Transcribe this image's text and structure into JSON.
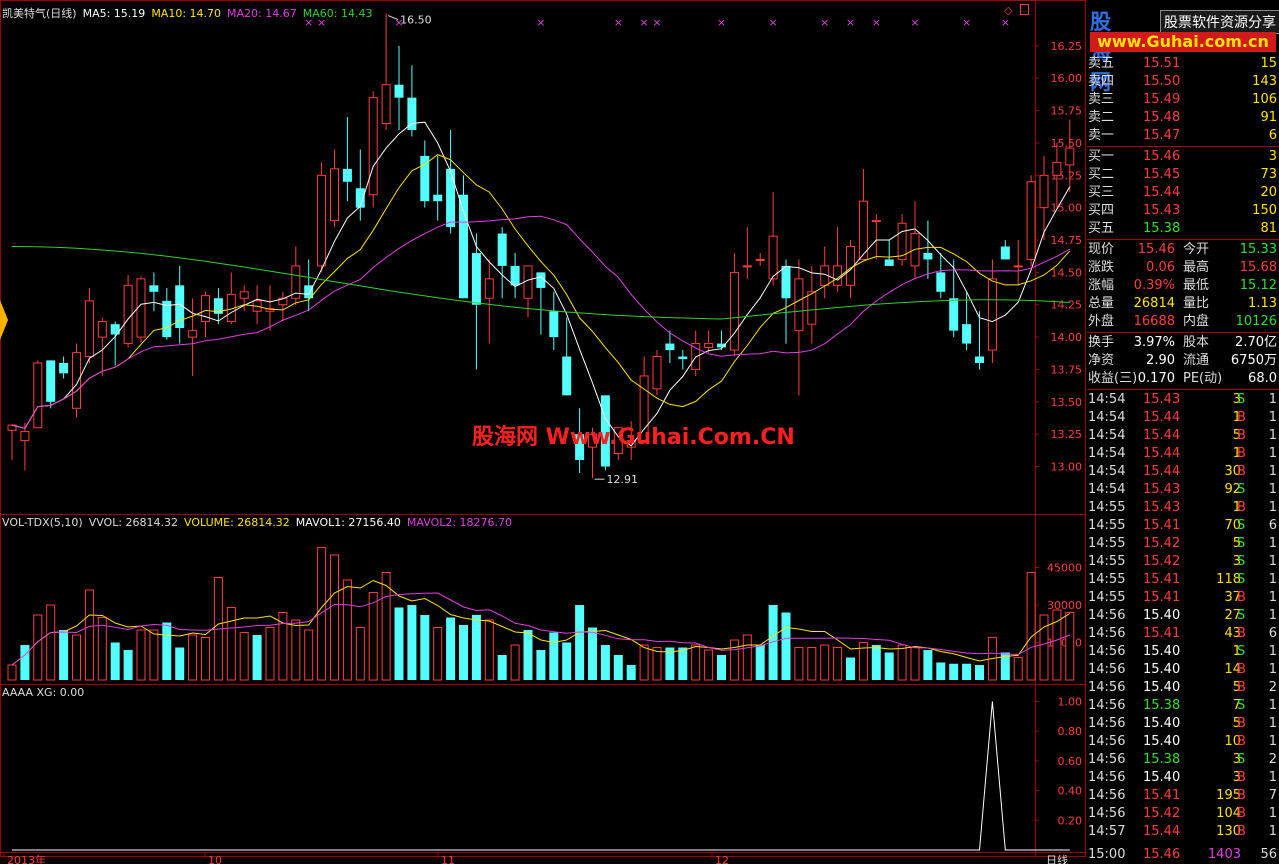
{
  "header": {
    "stock": "凯美特气(日线)",
    "ma5": "MA5: 15.19",
    "ma10": "MA10: 14.70",
    "ma20": "MA20: 14.67",
    "ma60": "MA60: 14.43"
  },
  "price_axis": [
    "16.25",
    "16.00",
    "15.75",
    "15.50",
    "15.25",
    "15.00",
    "14.75",
    "14.50",
    "14.25",
    "14.00",
    "13.75",
    "13.50",
    "13.25",
    "13.00"
  ],
  "annotations": {
    "high": "16.50",
    "low": "12.91"
  },
  "vol_header": {
    "name": "VOL-TDX(5,10)",
    "vvol": "VVOL: 26814.32",
    "volume": "VOLUME: 26814.32",
    "mavol1": "MAVOL1: 27156.40",
    "mavol2": "MAVOL2: 18276.70"
  },
  "vol_axis": [
    "45000",
    "30000",
    "15000"
  ],
  "ind_header": "AAAA XG: 0.00",
  "ind_axis": [
    "1.00",
    "0.80",
    "0.60",
    "0.40",
    "0.20"
  ],
  "date_axis": [
    "2013年",
    "10",
    "11",
    "12"
  ],
  "period_label": "日线",
  "watermark": "股海网 Www.Guhai.Com.CN",
  "logo": {
    "brand": "股海网",
    "sub": "股票软件资源分享",
    "url": "www.Guhai.com.cn"
  },
  "colors": {
    "up": "#ff3c3c",
    "down": "#54ffff",
    "ma5": "#ffffff",
    "ma10": "#ffe200",
    "ma20": "#e040e0",
    "ma60": "#30d030"
  },
  "order_book": {
    "asks": [
      {
        "label": "卖五",
        "price": "15.51",
        "vol": "15"
      },
      {
        "label": "卖四",
        "price": "15.50",
        "vol": "143"
      },
      {
        "label": "卖三",
        "price": "15.49",
        "vol": "106"
      },
      {
        "label": "卖二",
        "price": "15.48",
        "vol": "91"
      },
      {
        "label": "卖一",
        "price": "15.47",
        "vol": "6"
      }
    ],
    "bids": [
      {
        "label": "买一",
        "price": "15.46",
        "vol": "3"
      },
      {
        "label": "买二",
        "price": "15.45",
        "vol": "73"
      },
      {
        "label": "买三",
        "price": "15.44",
        "vol": "20"
      },
      {
        "label": "买四",
        "price": "15.43",
        "vol": "150"
      },
      {
        "label": "买五",
        "price": "15.38",
        "vol": "81"
      }
    ]
  },
  "quote": [
    {
      "l1": "现价",
      "v1": "15.46",
      "c1": "red",
      "l2": "今开",
      "v2": "15.33",
      "c2": "grn"
    },
    {
      "l1": "涨跌",
      "v1": "0.06",
      "c1": "red",
      "l2": "最高",
      "v2": "15.68",
      "c2": "red"
    },
    {
      "l1": "涨幅",
      "v1": "0.39%",
      "c1": "red",
      "l2": "最低",
      "v2": "15.12",
      "c2": "grn"
    },
    {
      "l1": "总量",
      "v1": "26814",
      "c1": "yel",
      "l2": "量比",
      "v2": "1.13",
      "c2": "yel"
    },
    {
      "l1": "外盘",
      "v1": "16688",
      "c1": "red",
      "l2": "内盘",
      "v2": "10126",
      "c2": "grn"
    }
  ],
  "fundamentals": [
    {
      "l1": "换手",
      "v1": "3.97%",
      "l2": "股本",
      "v2": "2.70亿"
    },
    {
      "l1": "净资",
      "v1": "2.90",
      "l2": "流通",
      "v2": "6750万"
    },
    {
      "l1": "收益(三)",
      "v1": "0.170",
      "l2": "PE(动)",
      "v2": "68.0"
    }
  ],
  "ticks": [
    {
      "t": "14:54",
      "p": "15.43",
      "v": "3",
      "bs": "S",
      "n": "1"
    },
    {
      "t": "14:54",
      "p": "15.44",
      "v": "1",
      "bs": "B",
      "n": "1"
    },
    {
      "t": "14:54",
      "p": "15.44",
      "v": "5",
      "bs": "B",
      "n": "1"
    },
    {
      "t": "14:54",
      "p": "15.44",
      "v": "1",
      "bs": "B",
      "n": "1"
    },
    {
      "t": "14:54",
      "p": "15.44",
      "v": "30",
      "bs": "B",
      "n": "1"
    },
    {
      "t": "14:54",
      "p": "15.43",
      "v": "92",
      "bs": "S",
      "n": "1"
    },
    {
      "t": "14:55",
      "p": "15.43",
      "v": "1",
      "bs": "B",
      "n": "1"
    },
    {
      "t": "14:55",
      "p": "15.41",
      "v": "70",
      "bs": "S",
      "n": "6"
    },
    {
      "t": "14:55",
      "p": "15.42",
      "v": "5",
      "bs": "S",
      "n": "1"
    },
    {
      "t": "14:55",
      "p": "15.42",
      "v": "3",
      "bs": "S",
      "n": "1"
    },
    {
      "t": "14:55",
      "p": "15.41",
      "v": "118",
      "bs": "S",
      "n": "1"
    },
    {
      "t": "14:55",
      "p": "15.41",
      "v": "37",
      "bs": "B",
      "n": "1"
    },
    {
      "t": "14:56",
      "p": "15.40",
      "v": "27",
      "bs": "S",
      "n": "1"
    },
    {
      "t": "14:56",
      "p": "15.41",
      "v": "43",
      "bs": "B",
      "n": "6"
    },
    {
      "t": "14:56",
      "p": "15.40",
      "v": "1",
      "bs": "S",
      "n": "1"
    },
    {
      "t": "14:56",
      "p": "15.40",
      "v": "14",
      "bs": "B",
      "n": "1"
    },
    {
      "t": "14:56",
      "p": "15.40",
      "v": "5",
      "bs": "B",
      "n": "2"
    },
    {
      "t": "14:56",
      "p": "15.38",
      "v": "7",
      "bs": "S",
      "n": "1"
    },
    {
      "t": "14:56",
      "p": "15.40",
      "v": "5",
      "bs": "B",
      "n": "1"
    },
    {
      "t": "14:56",
      "p": "15.40",
      "v": "10",
      "bs": "B",
      "n": "1"
    },
    {
      "t": "14:56",
      "p": "15.38",
      "v": "3",
      "bs": "S",
      "n": "2"
    },
    {
      "t": "14:56",
      "p": "15.40",
      "v": "3",
      "bs": "B",
      "n": "1"
    },
    {
      "t": "14:56",
      "p": "15.41",
      "v": "195",
      "bs": "B",
      "n": "7"
    },
    {
      "t": "14:56",
      "p": "15.42",
      "v": "104",
      "bs": "B",
      "n": "1"
    },
    {
      "t": "14:57",
      "p": "15.44",
      "v": "130",
      "bs": "B",
      "n": "1"
    }
  ],
  "ticks_partial": {
    "t": "15:00",
    "p": "15.46",
    "v": "1403",
    "n": "56"
  },
  "chart_data": {
    "type": "candlestick",
    "title": "凯美特气(日线)",
    "ylim": [
      12.78,
      16.45
    ],
    "candles": [
      [
        13.28,
        13.32,
        13.05,
        13.32
      ],
      [
        13.2,
        13.34,
        12.97,
        13.27
      ],
      [
        13.3,
        13.82,
        13.3,
        13.8
      ],
      [
        13.82,
        13.82,
        13.45,
        13.5
      ],
      [
        13.8,
        13.85,
        13.68,
        13.72
      ],
      [
        13.45,
        13.95,
        13.38,
        13.88
      ],
      [
        13.85,
        14.38,
        13.8,
        14.28
      ],
      [
        14.0,
        14.15,
        13.7,
        14.12
      ],
      [
        14.1,
        14.12,
        13.78,
        14.02
      ],
      [
        13.95,
        14.48,
        13.92,
        14.4
      ],
      [
        14.0,
        14.47,
        13.96,
        14.45
      ],
      [
        14.4,
        14.5,
        14.2,
        14.35
      ],
      [
        14.28,
        14.38,
        13.98,
        14.0
      ],
      [
        14.4,
        14.55,
        13.95,
        14.07
      ],
      [
        14.0,
        14.3,
        13.7,
        14.05
      ],
      [
        14.12,
        14.35,
        14.0,
        14.32
      ],
      [
        14.3,
        14.38,
        14.1,
        14.18
      ],
      [
        14.12,
        14.5,
        14.1,
        14.33
      ],
      [
        14.3,
        14.4,
        14.2,
        14.35
      ],
      [
        14.2,
        14.4,
        14.1,
        14.28
      ],
      [
        14.2,
        14.4,
        14.05,
        14.22
      ],
      [
        14.25,
        14.35,
        14.12,
        14.3
      ],
      [
        14.3,
        14.7,
        14.25,
        14.55
      ],
      [
        14.4,
        14.6,
        14.2,
        14.3
      ],
      [
        14.55,
        15.35,
        14.5,
        15.25
      ],
      [
        14.9,
        15.45,
        14.85,
        15.3
      ],
      [
        15.3,
        15.7,
        15.05,
        15.2
      ],
      [
        15.15,
        15.45,
        14.9,
        15.0
      ],
      [
        15.1,
        15.9,
        15.0,
        15.85
      ],
      [
        15.65,
        16.5,
        15.6,
        15.95
      ],
      [
        15.95,
        16.25,
        15.6,
        15.85
      ],
      [
        15.85,
        16.1,
        15.55,
        15.6
      ],
      [
        15.4,
        15.52,
        15.0,
        15.05
      ],
      [
        15.1,
        15.4,
        14.9,
        15.05
      ],
      [
        15.3,
        15.6,
        14.8,
        14.85
      ],
      [
        15.1,
        15.25,
        14.3,
        14.3
      ],
      [
        14.65,
        14.8,
        13.75,
        14.25
      ],
      [
        14.3,
        14.6,
        13.95,
        14.45
      ],
      [
        14.8,
        14.85,
        14.3,
        14.55
      ],
      [
        14.55,
        14.65,
        14.3,
        14.4
      ],
      [
        14.3,
        14.55,
        14.15,
        14.55
      ],
      [
        14.5,
        14.5,
        14.02,
        14.38
      ],
      [
        14.2,
        14.35,
        13.9,
        14.0
      ],
      [
        13.85,
        14.15,
        13.55,
        13.55
      ],
      [
        13.25,
        13.45,
        12.95,
        13.05
      ],
      [
        13.15,
        13.3,
        12.91,
        13.25
      ],
      [
        13.55,
        13.55,
        12.97,
        13.0
      ],
      [
        13.1,
        13.3,
        13.05,
        13.3
      ],
      [
        13.15,
        13.35,
        13.05,
        13.2
      ],
      [
        13.2,
        13.85,
        13.2,
        13.7
      ],
      [
        13.6,
        13.9,
        13.55,
        13.85
      ],
      [
        13.95,
        14.05,
        13.8,
        13.9
      ],
      [
        13.85,
        13.9,
        13.75,
        13.83
      ],
      [
        13.75,
        14.05,
        13.7,
        13.95
      ],
      [
        13.92,
        14.05,
        13.88,
        13.95
      ],
      [
        13.95,
        14.05,
        13.9,
        13.92
      ],
      [
        13.9,
        14.65,
        13.85,
        14.5
      ],
      [
        14.55,
        14.85,
        14.45,
        14.55
      ],
      [
        14.6,
        14.65,
        14.55,
        14.6
      ],
      [
        14.45,
        15.12,
        14.4,
        14.78
      ],
      [
        14.55,
        14.6,
        13.95,
        14.3
      ],
      [
        14.05,
        14.6,
        13.55,
        14.45
      ],
      [
        14.1,
        14.55,
        13.95,
        14.35
      ],
      [
        14.4,
        14.7,
        14.3,
        14.55
      ],
      [
        14.4,
        14.85,
        14.35,
        14.55
      ],
      [
        14.4,
        14.75,
        14.3,
        14.7
      ],
      [
        14.6,
        15.3,
        14.6,
        15.05
      ],
      [
        14.9,
        14.95,
        14.6,
        14.9
      ],
      [
        14.6,
        14.75,
        14.55,
        14.55
      ],
      [
        14.6,
        14.95,
        14.55,
        14.88
      ],
      [
        14.55,
        15.05,
        14.45,
        14.8
      ],
      [
        14.65,
        14.9,
        14.45,
        14.6
      ],
      [
        14.5,
        14.65,
        14.3,
        14.35
      ],
      [
        14.3,
        14.6,
        14.0,
        14.05
      ],
      [
        14.1,
        14.35,
        13.9,
        13.95
      ],
      [
        13.85,
        14.2,
        13.75,
        13.8
      ],
      [
        13.9,
        14.6,
        13.8,
        14.45
      ],
      [
        14.7,
        14.75,
        14.6,
        14.6
      ],
      [
        14.55,
        14.75,
        14.4,
        14.55
      ],
      [
        14.6,
        15.25,
        14.55,
        15.2
      ],
      [
        15.0,
        15.4,
        14.75,
        15.25
      ],
      [
        15.25,
        15.5,
        15.0,
        15.35
      ],
      [
        15.33,
        15.68,
        15.12,
        15.46
      ]
    ],
    "volume": [
      {
        "v": 6000,
        "up": true
      },
      {
        "v": 14000,
        "up": false
      },
      {
        "v": 26000,
        "up": true
      },
      {
        "v": 30000,
        "up": true
      },
      {
        "v": 20000,
        "up": false
      },
      {
        "v": 18000,
        "up": true
      },
      {
        "v": 36000,
        "up": true
      },
      {
        "v": 25000,
        "up": true
      },
      {
        "v": 15000,
        "up": false
      },
      {
        "v": 12000,
        "up": false
      },
      {
        "v": 20000,
        "up": true
      },
      {
        "v": 20000,
        "up": true
      },
      {
        "v": 23000,
        "up": false
      },
      {
        "v": 13000,
        "up": false
      },
      {
        "v": 18000,
        "up": true
      },
      {
        "v": 17000,
        "up": true
      },
      {
        "v": 41000,
        "up": true
      },
      {
        "v": 29000,
        "up": true
      },
      {
        "v": 19000,
        "up": true
      },
      {
        "v": 18000,
        "up": false
      },
      {
        "v": 21000,
        "up": true
      },
      {
        "v": 27000,
        "up": true
      },
      {
        "v": 24000,
        "up": true
      },
      {
        "v": 20000,
        "up": true
      },
      {
        "v": 53000,
        "up": true
      },
      {
        "v": 50000,
        "up": true
      },
      {
        "v": 40000,
        "up": true
      },
      {
        "v": 21000,
        "up": true
      },
      {
        "v": 35000,
        "up": true
      },
      {
        "v": 43000,
        "up": true
      },
      {
        "v": 29000,
        "up": false
      },
      {
        "v": 30000,
        "up": false
      },
      {
        "v": 26000,
        "up": false
      },
      {
        "v": 21000,
        "up": true
      },
      {
        "v": 25000,
        "up": false
      },
      {
        "v": 22000,
        "up": false
      },
      {
        "v": 26000,
        "up": false
      },
      {
        "v": 24000,
        "up": true
      },
      {
        "v": 10000,
        "up": false
      },
      {
        "v": 14000,
        "up": true
      },
      {
        "v": 20000,
        "up": false
      },
      {
        "v": 12000,
        "up": false
      },
      {
        "v": 19000,
        "up": false
      },
      {
        "v": 15000,
        "up": false
      },
      {
        "v": 30000,
        "up": false
      },
      {
        "v": 21000,
        "up": false
      },
      {
        "v": 14000,
        "up": false
      },
      {
        "v": 10000,
        "up": false
      },
      {
        "v": 6000,
        "up": false
      },
      {
        "v": 14000,
        "up": true
      },
      {
        "v": 13000,
        "up": true
      },
      {
        "v": 13000,
        "up": false
      },
      {
        "v": 13000,
        "up": false
      },
      {
        "v": 14000,
        "up": true
      },
      {
        "v": 12000,
        "up": true
      },
      {
        "v": 10000,
        "up": false
      },
      {
        "v": 16000,
        "up": true
      },
      {
        "v": 18000,
        "up": true
      },
      {
        "v": 14000,
        "up": false
      },
      {
        "v": 30000,
        "up": false
      },
      {
        "v": 27000,
        "up": false
      },
      {
        "v": 13000,
        "up": true
      },
      {
        "v": 13000,
        "up": true
      },
      {
        "v": 14000,
        "up": true
      },
      {
        "v": 13000,
        "up": true
      },
      {
        "v": 9000,
        "up": false
      },
      {
        "v": 15000,
        "up": true
      },
      {
        "v": 14000,
        "up": false
      },
      {
        "v": 11000,
        "up": false
      },
      {
        "v": 14000,
        "up": true
      },
      {
        "v": 13000,
        "up": true
      },
      {
        "v": 12000,
        "up": false
      },
      {
        "v": 7000,
        "up": false
      },
      {
        "v": 6500,
        "up": false
      },
      {
        "v": 6500,
        "up": false
      },
      {
        "v": 6000,
        "up": false
      },
      {
        "v": 17000,
        "up": true
      },
      {
        "v": 11000,
        "up": false
      },
      {
        "v": 9000,
        "up": true
      },
      {
        "v": 43000,
        "up": true
      },
      {
        "v": 26000,
        "up": true
      },
      {
        "v": 28000,
        "up": true
      },
      {
        "v": 27000,
        "up": true
      }
    ],
    "xg_spike_index": 76,
    "vol_ylim": [
      0,
      56000
    ]
  }
}
